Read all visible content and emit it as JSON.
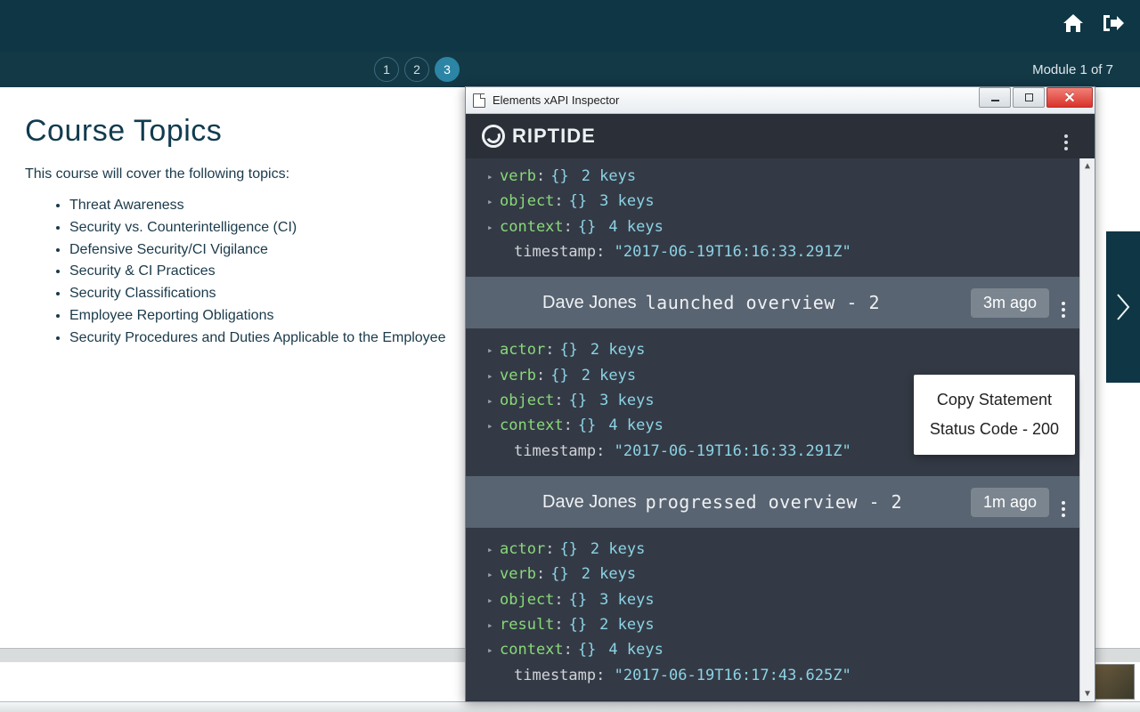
{
  "header": {
    "pages": [
      "1",
      "2",
      "3"
    ],
    "active_page_index": 2,
    "module_label": "Module 1 of 7"
  },
  "course": {
    "title": "Course Topics",
    "intro": "This course will cover the following topics:",
    "topics": [
      "Threat Awareness",
      "Security vs. Counterintelligence (CI)",
      "Defensive Security/CI Vigilance",
      "Security & CI Practices",
      "Security Classifications",
      "Employee Reporting Obligations",
      "Security Procedures and Duties Applicable to the Employee"
    ]
  },
  "inspector": {
    "window_title": "Elements xAPI Inspector",
    "brand": "RIPTIDE",
    "popup": {
      "copy": "Copy Statement",
      "status": "Status Code - 200"
    },
    "top_partial": {
      "rows": [
        {
          "key": "verb",
          "keys": 2
        },
        {
          "key": "object",
          "keys": 3
        },
        {
          "key": "context",
          "keys": 4
        }
      ],
      "timestamp": "\"2017-06-19T16:16:33.291Z\""
    },
    "statements": [
      {
        "who": "Dave Jones",
        "what": "launched overview - 2",
        "ago": "3m ago",
        "rows": [
          {
            "key": "actor",
            "keys": 2
          },
          {
            "key": "verb",
            "keys": 2
          },
          {
            "key": "object",
            "keys": 3
          },
          {
            "key": "context",
            "keys": 4
          }
        ],
        "timestamp": "\"2017-06-19T16:16:33.291Z\""
      },
      {
        "who": "Dave Jones",
        "what": "progressed overview - 2",
        "ago": "1m ago",
        "rows": [
          {
            "key": "actor",
            "keys": 2
          },
          {
            "key": "verb",
            "keys": 2
          },
          {
            "key": "object",
            "keys": 3
          },
          {
            "key": "result",
            "keys": 2
          },
          {
            "key": "context",
            "keys": 4
          }
        ],
        "timestamp": "\"2017-06-19T16:17:43.625Z\""
      }
    ]
  }
}
